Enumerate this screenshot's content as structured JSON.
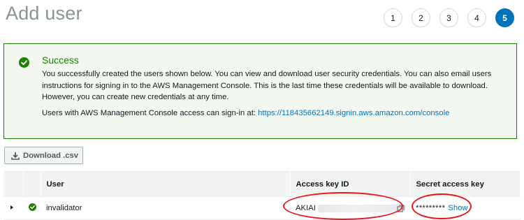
{
  "page": {
    "title": "Add user"
  },
  "steps": [
    {
      "label": "1",
      "active": false
    },
    {
      "label": "2",
      "active": false
    },
    {
      "label": "3",
      "active": false
    },
    {
      "label": "4",
      "active": false
    },
    {
      "label": "5",
      "active": true
    }
  ],
  "alert": {
    "status": "success",
    "icon": "check-circle-icon",
    "title": "Success",
    "body": "You successfully created the users shown below. You can view and download user security credentials. You can also email users instructions for signing in to the AWS Management Console. This is the last time these credentials will be available to download. However, you can create new credentials at any time.",
    "console_prefix": "Users with AWS Management Console access can sign-in at:",
    "console_url": "https://118435662149.signin.aws.amazon.com/console"
  },
  "toolbar": {
    "download_label": "Download .csv",
    "download_icon": "download-icon"
  },
  "table": {
    "columns": [
      "",
      "",
      "User",
      "Access key ID",
      "Secret access key"
    ],
    "rows": [
      {
        "expand_icon": "caret-right-icon",
        "status_icon": "check-circle-icon",
        "user": "invalidator",
        "access_key_prefix": "AKIAI",
        "secret_masked": "*********",
        "show_label": "Show"
      }
    ]
  },
  "colors": {
    "accent": "#0073bb",
    "success": "#1d8102",
    "annotation": "#e8161b"
  }
}
